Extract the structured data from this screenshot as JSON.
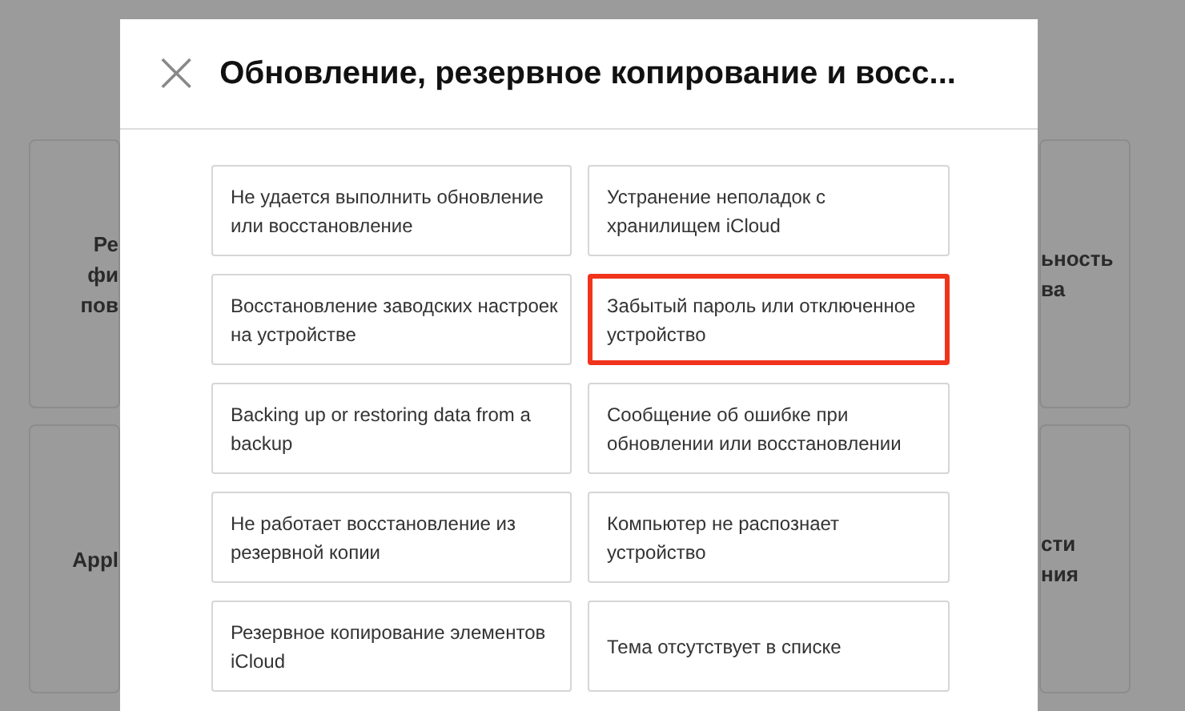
{
  "background": {
    "cards": [
      {
        "kind": "left",
        "lines": [
          "Ре",
          "фи",
          "пов"
        ]
      },
      {
        "kind": "right",
        "lines": [
          "ьность",
          "ва"
        ]
      },
      {
        "kind": "left",
        "lines": [
          "Appl"
        ]
      },
      {
        "kind": "right",
        "lines": [
          "сти",
          "ния"
        ]
      }
    ]
  },
  "modal": {
    "close": "×",
    "title": "Обновление, резервное копирование и восс...",
    "topics": [
      {
        "label": "Не удается выполнить обновление или восстановление",
        "selected": false
      },
      {
        "label": "Устранение неполадок с хранилищем iCloud",
        "selected": false
      },
      {
        "label": "Восстановление заводских настроек на устройстве",
        "selected": false
      },
      {
        "label": "Забытый пароль или отключенное устройство",
        "selected": true
      },
      {
        "label": "Backing up or restoring data from a backup",
        "selected": false
      },
      {
        "label": "Сообщение об ошибке при обновлении или восстановлении",
        "selected": false
      },
      {
        "label": "Не работает восстановление из резервной копии",
        "selected": false
      },
      {
        "label": "Компьютер не распознает устройство",
        "selected": false
      },
      {
        "label": "Резервное копирование элементов iCloud",
        "selected": false
      },
      {
        "label": "Тема отсутствует в списке",
        "selected": false
      }
    ]
  }
}
